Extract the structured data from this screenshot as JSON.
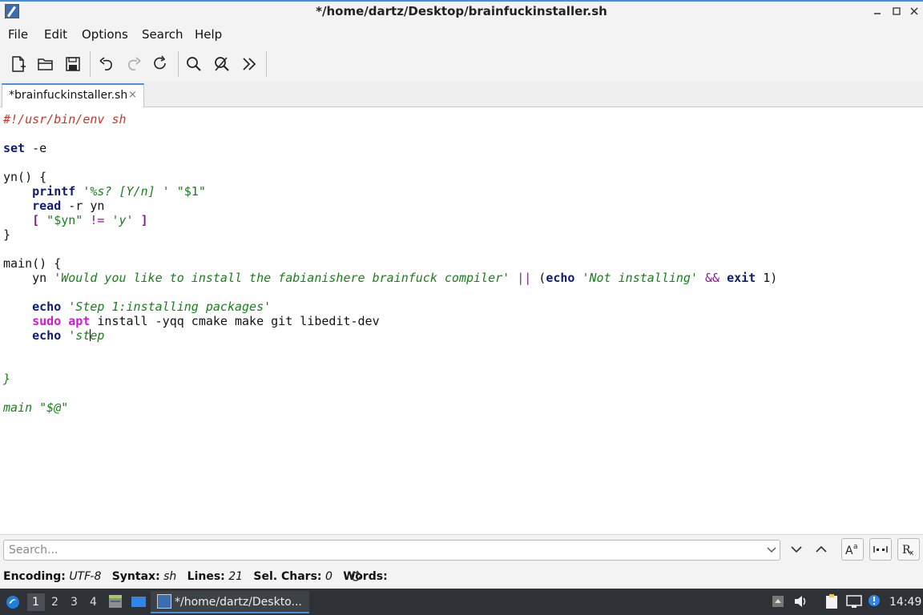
{
  "window": {
    "title": "*/home/dartz/Desktop/brainfuckinstaller.sh"
  },
  "menu": [
    "File",
    "Edit",
    "Options",
    "Search",
    "Help"
  ],
  "tab": {
    "label": "*brainfuckinstaller.sh",
    "close": "×"
  },
  "code": {
    "l1": "#!/usr/bin/env sh",
    "set": "set",
    "set_arg": " -e",
    "yn_open": "yn() {",
    "printf": "printf",
    "printf_fmt": "'%s? [Y/n] '",
    "printf_arg": " \"$1\"",
    "read": "read",
    "read_arg": " -r yn",
    "test_open": "[",
    "test_var": " \"$yn\" ",
    "test_ne": "!=",
    "test_y": "'y'",
    "test_close": "]",
    "close1": "}",
    "main_open": "main() {",
    "yn_call": "yn ",
    "question": "'Would you like to install the fabianishere brainfuck compiler'",
    "or": "||",
    "paren_open": " (",
    "echo": "echo",
    "not_installing": "'Not installing'",
    "and": "&&",
    "exit": "exit",
    "exit_arg": " 1)",
    "step1": "'Step 1:installing packages'",
    "sudo": "sudo",
    "apt": "apt",
    "apt_args": " install -yqq cmake make git libedit-dev",
    "step_a": "'st",
    "step_b": "ep",
    "close2": "}",
    "main_call": "main \"$@\""
  },
  "search": {
    "placeholder": "Search..."
  },
  "status": {
    "encoding_label": "Encoding:",
    "encoding": "UTF-8",
    "syntax_label": "Syntax:",
    "syntax": "sh",
    "lines_label": "Lines:",
    "lines": "21",
    "sel_label": "Sel. Chars:",
    "sel": "0",
    "words_label": "Words:"
  },
  "taskbar": {
    "workspaces": [
      "1",
      "2",
      "3",
      "4"
    ],
    "task_label": "*/home/dartz/Deskto...",
    "clock": "14:49"
  }
}
